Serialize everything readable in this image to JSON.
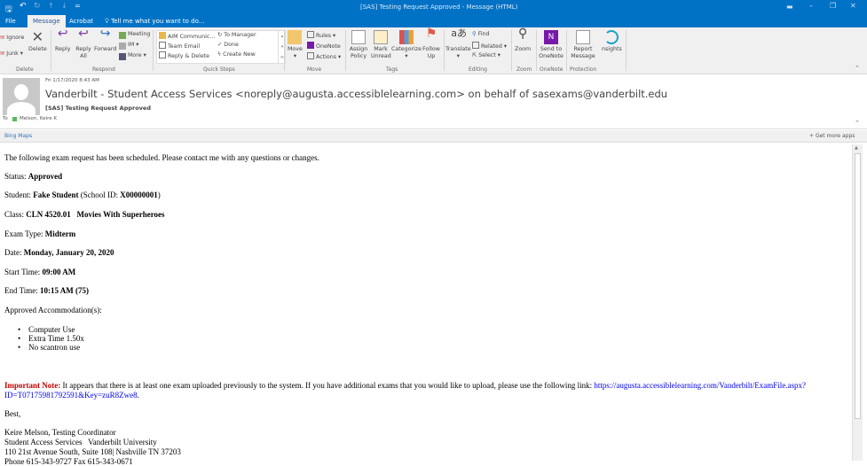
{
  "window": {
    "title": "[SAS] Testing Request Approved - Message (HTML)"
  },
  "tabs": [
    {
      "label": "File"
    },
    {
      "label": "Message"
    },
    {
      "label": "Acrobat"
    }
  ],
  "tell_me": "Tell me what you want to do...",
  "ribbon": {
    "delete": {
      "ignore": "Ignore",
      "junk": "Junk",
      "delete": "Delete",
      "group": "Delete"
    },
    "respond": {
      "reply": "Reply",
      "reply_all": "Reply All",
      "forward": "Forward",
      "meeting": "Meeting",
      "im": "IM",
      "more": "More",
      "group": "Respond"
    },
    "quick_steps": {
      "items": [
        "AIM Communic...",
        "Team Email",
        "Reply & Delete",
        "To Manager",
        "Done",
        "Create New"
      ],
      "group": "Quick Steps"
    },
    "move": {
      "move": "Move",
      "rules": "Rules",
      "onenote": "OneNote",
      "actions": "Actions",
      "group": "Move"
    },
    "tags": {
      "assign_policy": "Assign Policy",
      "mark_unread": "Mark Unread",
      "categorize": "Categorize",
      "follow_up": "Follow Up",
      "group": "Tags"
    },
    "editing": {
      "translate": "Translate",
      "find": "Find",
      "related": "Related",
      "select": "Select",
      "group": "Editing"
    },
    "zoom": {
      "zoom": "Zoom",
      "group": "Zoom"
    },
    "onenote": {
      "send": "Send to OneNote",
      "group": "OneNote"
    },
    "protection": {
      "report": "Report Message",
      "group": "Protection"
    },
    "insights": {
      "label": "nsights"
    }
  },
  "message": {
    "date": "Fri 1/17/2020 8:43 AM",
    "from": "Vanderbilt - Student Access Services <noreply@augusta.accessiblelearning.com> on behalf of sasexams@vanderbilt.edu",
    "subject": "[SAS] Testing Request Approved",
    "to_label": "To",
    "to": "Melson, Keire K"
  },
  "apps": {
    "bing": "Bing Maps",
    "get_more": "Get more apps"
  },
  "body": {
    "intro": "The following exam request has been scheduled. Please contact me with any questions or changes.",
    "fields": [
      {
        "label": "Status: ",
        "value": "Approved"
      },
      {
        "label": "Student: ",
        "value": "Fake Student",
        "extra": " (School ID: ",
        "id": "X00000001",
        ")": ")"
      },
      {
        "label": "Class: ",
        "value": "CLN 4520.01   Movies With Superheroes"
      },
      {
        "label": "Exam Type: ",
        "value": "Midterm"
      },
      {
        "label": "Date: ",
        "value": "Monday, January 20, 2020"
      },
      {
        "label": "Start Time: ",
        "value": "09:00 AM"
      },
      {
        "label": "End Time: ",
        "value": "10:15 AM (75)"
      }
    ],
    "accommodations_label": "Approved Accommodation(s):",
    "accommodations": [
      "Computer Use",
      "Extra Time 1.50x",
      "No scantron use"
    ],
    "note_label": "Important Note:",
    "note_text": " It appears that there is at least one exam uploaded previously to the system. If you have additional exams that you would like to upload, please use the following link: ",
    "link_line1": "https://augusta.accessiblelearning.com/Vanderbilt/ExamFile.aspx?",
    "link_line2": "ID=T07175981792591&Key=zuR8Zwe8",
    "closing": "Best,",
    "signature": [
      "Keire Melson, Testing Coordinator",
      "Student Access Services   Vanderbilt University",
      "110 21st Avenue South, Suite 108| Nashville TN 37203",
      "Phone 615-343-9727 Fax 615-343-0671"
    ]
  },
  "colors": {
    "brand": "#0072c6",
    "note": "#c00000",
    "link": "#0000ee"
  }
}
